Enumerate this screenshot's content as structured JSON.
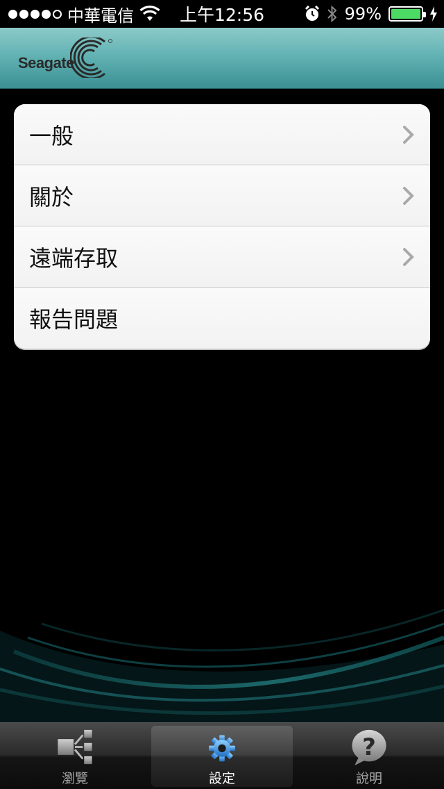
{
  "status_bar": {
    "carrier": "中華電信",
    "time": "上午12:56",
    "battery": "99%",
    "battery_level": 0.99
  },
  "header": {
    "logo_text": "Seagate"
  },
  "menu": {
    "items": [
      {
        "label": "一般",
        "has_chevron": true
      },
      {
        "label": "關於",
        "has_chevron": true
      },
      {
        "label": "遠端存取",
        "has_chevron": true
      },
      {
        "label": "報告問題",
        "has_chevron": false
      }
    ]
  },
  "tab_bar": {
    "tabs": [
      {
        "label": "瀏覽",
        "icon": "browse-icon",
        "selected": false
      },
      {
        "label": "設定",
        "icon": "gear-icon",
        "selected": true
      },
      {
        "label": "說明",
        "icon": "help-icon",
        "selected": false
      }
    ]
  },
  "colors": {
    "header_teal": "#5fb0b1",
    "battery_green": "#4cd964",
    "gear_blue": "#2f8ee0"
  }
}
